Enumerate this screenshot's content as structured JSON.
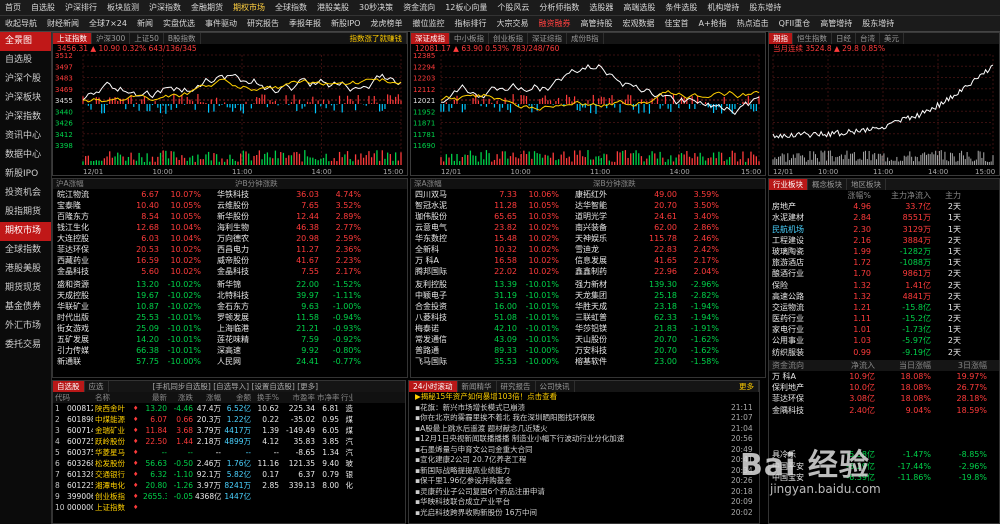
{
  "menu1": [
    "首页",
    "自选股",
    "沪深排行",
    "板块监测",
    "沪深指数",
    "金融期货",
    "期权市场",
    "全球指数",
    "港股美股",
    "30秒决策",
    "资金流向",
    "12板心向量",
    "个股风云",
    "分析师指数",
    "选股器",
    "高端选股",
    "条件选股",
    "机构增持",
    "股东增持"
  ],
  "menu2": [
    "收起导航",
    "财经新闻",
    "全球7×24",
    "新闻",
    "实盘优选",
    "事件驱动",
    "研究报告",
    "季报年报",
    "新股IPO",
    "龙虎榜单",
    "撤位监控",
    "指标排行",
    "大宗交易",
    "融资融券",
    "高管持股",
    "宏观数据",
    "佳宝首",
    "A+抢指",
    "热点追击",
    "QFII重仓",
    "高管增持",
    "股东增持"
  ],
  "sidebar": [
    "全景图",
    "自选股",
    "沪深个股",
    "沪深板块",
    "沪深指数",
    "资讯中心",
    "数据中心",
    "新股IPO",
    "投资机会",
    "股指期货",
    "期权市场",
    "全球指数",
    "港股美股",
    "期货现货",
    "基金债券",
    "外汇市场",
    "委托交易"
  ],
  "p1": {
    "tabs": [
      "上证指数",
      "沪深300",
      "上证50",
      "B股指数"
    ],
    "right": "指数涨了就赚钱",
    "info": "3456.31 ▲ 10.90  0.32%  643/136/345",
    "yl": [
      "3512",
      "3497",
      "3483",
      "3469",
      "3455",
      "3440",
      "3426",
      "3412",
      "3398"
    ],
    "xl": [
      "12/01",
      "10:00",
      "11:00",
      "14:00",
      "15:00"
    ]
  },
  "p2": {
    "tabs": [
      "深证成指",
      "中小板指",
      "创业板指",
      "深证综指",
      "成份B指"
    ],
    "info": "12081.17 ▲ 63.90  0.53%  783/248/760",
    "yl": [
      "12385",
      "12294",
      "12203",
      "12112",
      "12021",
      "11952",
      "11871",
      "11781",
      "11690"
    ],
    "xl": [
      "12/01",
      "10:00",
      "11:00",
      "14:00",
      "15:00"
    ]
  },
  "p3": {
    "tabs": [
      "期指",
      "恒生指数",
      "日经",
      "台湾",
      "美元"
    ],
    "info": "当月连续  3524.8 ▲ 29.8  0.85%",
    "xl": [
      "12/01",
      "10:00",
      "11:00",
      "14:00",
      "15:00"
    ]
  },
  "rankL": {
    "hdA": "沪A涨幅",
    "hdB": "沪B分钟涨跌",
    "up": [
      [
        "皖江物流",
        "6.67",
        "10.07%",
        "华铁科技",
        "36.03",
        "4.74%"
      ],
      [
        "宝泰隆",
        "10.40",
        "10.05%",
        "云维股份",
        "7.65",
        "3.52%"
      ],
      [
        "百隆东方",
        "8.54",
        "10.05%",
        "新华股份",
        "12.44",
        "2.89%"
      ],
      [
        "钱江生化",
        "12.68",
        "10.04%",
        "海利生物",
        "46.38",
        "2.77%"
      ],
      [
        "大连控股",
        "6.03",
        "10.04%",
        "万向德农",
        "20.98",
        "2.59%"
      ],
      [
        "菲达环保",
        "20.53",
        "10.02%",
        "西昌电力",
        "11.27",
        "2.36%"
      ],
      [
        "西藏药业",
        "16.59",
        "10.02%",
        "威帝股份",
        "41.67",
        "2.23%"
      ],
      [
        "金晶科技",
        "5.60",
        "10.02%",
        "金晶科技",
        "7.55",
        "2.17%"
      ]
    ],
    "dn": [
      [
        "盛和资源",
        "13.20",
        "-10.02%",
        "新华锦",
        "22.00",
        "-1.52%"
      ],
      [
        "天成控股",
        "19.67",
        "-10.02%",
        "北特科技",
        "39.97",
        "-1.11%"
      ],
      [
        "华联矿业",
        "10.87",
        "-10.02%",
        "金石东方",
        "9.63",
        "-1.00%"
      ],
      [
        "时代出版",
        "25.53",
        "-10.01%",
        "罗顿发展",
        "11.58",
        "-0.94%"
      ],
      [
        "街女游戏",
        "25.09",
        "-10.01%",
        "上海临港",
        "21.21",
        "-0.93%"
      ],
      [
        "五矿发展",
        "14.20",
        "-10.01%",
        "莲花味精",
        "7.59",
        "-0.92%"
      ],
      [
        "引力传媒",
        "66.38",
        "-10.01%",
        "深高速",
        "9.92",
        "-0.80%"
      ],
      [
        "新通联",
        "57.75",
        "-10.00%",
        "人民网",
        "24.41",
        "-0.77%"
      ]
    ]
  },
  "rankR": {
    "hdA": "深A涨幅",
    "hdB": "深B分钟涨跌",
    "up": [
      [
        "四川双马",
        "7.33",
        "10.06%",
        "康拓红外",
        "49.00",
        "3.59%"
      ],
      [
        "智冠水泥",
        "11.28",
        "10.05%",
        "达华智能",
        "20.70",
        "3.50%"
      ],
      [
        "珈伟股份",
        "65.65",
        "10.03%",
        "道明光学",
        "24.61",
        "3.40%"
      ],
      [
        "云意电气",
        "23.82",
        "10.02%",
        "南兴装备",
        "62.00",
        "2.86%"
      ],
      [
        "华东数控",
        "15.48",
        "10.02%",
        "天神娱乐",
        "115.78",
        "2.46%"
      ],
      [
        "全新科",
        "10.32",
        "10.02%",
        "雪迪龙",
        "22.83",
        "2.42%"
      ],
      [
        "万 科A",
        "16.58",
        "10.02%",
        "信息发展",
        "41.65",
        "2.17%"
      ],
      [
        "腾邦国际",
        "22.02",
        "10.02%",
        "鑫鑫制药",
        "22.96",
        "2.04%"
      ]
    ],
    "dn": [
      [
        "友利控股",
        "13.39",
        "-10.01%",
        "强力新材",
        "139.30",
        "-2.96%"
      ],
      [
        "中颖电子",
        "31.19",
        "-10.01%",
        "天龙集团",
        "25.18",
        "-2.82%"
      ],
      [
        "合金投资",
        "16.00",
        "-10.01%",
        "华胜天成",
        "23.18",
        "-1.94%"
      ],
      [
        "八菱科技",
        "51.08",
        "-10.01%",
        "三联虹普",
        "62.33",
        "-1.94%"
      ],
      [
        "梅泰诺",
        "42.10",
        "-10.01%",
        "华莎铝镁",
        "21.83",
        "-1.91%"
      ],
      [
        "常发通信",
        "43.09",
        "-10.01%",
        "天山股份",
        "20.70",
        "-1.62%"
      ],
      [
        "普路通",
        "89.33",
        "-10.00%",
        "万安科技",
        "20.70",
        "-1.62%"
      ],
      [
        "飞马国际",
        "35.53",
        "-10.00%",
        "榕基软件",
        "23.00",
        "-1.58%"
      ]
    ]
  },
  "sector": {
    "tabs": [
      "行业板块",
      "概念板块",
      "地区板块"
    ],
    "hd": [
      "",
      "涨幅%",
      "主力净流入",
      "主力"
    ],
    "rows": [
      [
        "房地产",
        "4.96",
        "33.7亿",
        "2天"
      ],
      [
        "水泥建材",
        "2.84",
        "8551万",
        "1天"
      ],
      [
        "民航机场",
        "2.30",
        "3129万",
        "1天"
      ],
      [
        "工程建设",
        "2.16",
        "3884万",
        "2天"
      ],
      [
        "玻璃陶瓷",
        "1.99",
        "-1282万",
        "1天"
      ],
      [
        "旅游酒店",
        "1.72",
        "-1088万",
        "1天"
      ],
      [
        "酿酒行业",
        "1.70",
        "9861万",
        "2天"
      ],
      [
        "保险",
        "1.32",
        "1.41亿",
        "2天"
      ],
      [
        "高速公路",
        "1.32",
        "4841万",
        "2天"
      ],
      [
        "交运物流",
        "1.21",
        "-15.8亿",
        "1天"
      ],
      [
        "医药行业",
        "1.11",
        "-15.2亿",
        "2天"
      ],
      [
        "家电行业",
        "1.01",
        "-1.73亿",
        "1天"
      ],
      [
        "公用事业",
        "1.03",
        "-5.97亿",
        "2天"
      ],
      [
        "纺织服装",
        "0.99",
        "-9.19亿",
        "2天"
      ]
    ],
    "hd2": [
      "资金流向",
      "净流入",
      "当日涨幅",
      "3日涨幅"
    ],
    "flow": [
      [
        "万 科A",
        "10.9亿",
        "18.08%",
        "19.97%"
      ],
      [
        "保利地产",
        "10.0亿",
        "18.08%",
        "26.77%"
      ],
      [
        "菲达环保",
        "3.08亿",
        "18.08%",
        "28.18%"
      ],
      [
        "金隅科技",
        "2.40亿",
        "9.04%",
        "18.59%"
      ],
      [
        "",
        "",
        "",
        "",
        ""
      ],
      [
        "",
        "",
        "",
        ""
      ],
      [
        "",
        "",
        "",
        ""
      ],
      [
        "具冷乐",
        "-5.38亿",
        "-1.47%",
        "-8.85%"
      ],
      [
        "中国平安",
        "-6.29亿",
        "-17.44%",
        "-2.96%"
      ],
      [
        "中国宝安",
        "-6.39亿",
        "-11.86%",
        "-19.8%"
      ]
    ]
  },
  "wl": {
    "tabs": [
      "自选股",
      "应选"
    ],
    "mid": "[手机同步自选股] [自选导入] [设置自选股] [更多]",
    "hd": [
      "代码",
      "名称",
      "",
      "最新",
      "涨跌",
      "涨幅",
      "金额",
      "换手%",
      "市盈率",
      "市净率",
      "行业"
    ],
    "rows": [
      [
        "1",
        "000812",
        "陕西金叶",
        "13.20",
        "-4.46",
        "47.4万",
        "6.52亿",
        "10.62",
        "225.34",
        "6.81",
        "造"
      ],
      [
        "2",
        "601898",
        "中煤能源",
        "6.07",
        "0.66",
        "20.3万",
        "1.22亿",
        "0.22",
        "-35.02",
        "0.95",
        "煤"
      ],
      [
        "3",
        "600714",
        "金瑞矿业",
        "11.84",
        "3.68",
        "3.79万",
        "4417万",
        "1.39",
        "-149.49",
        "6.05",
        "煤"
      ],
      [
        "4",
        "600725",
        "跃岭股份",
        "22.50",
        "1.44",
        "2.18万",
        "4899万",
        "4.12",
        "35.83",
        "3.85",
        "汽"
      ],
      [
        "5",
        "600375",
        "华菱星马",
        "--",
        "--",
        "--",
        "--",
        "--",
        "-8.65",
        "1.34",
        "汽"
      ],
      [
        "6",
        "603268",
        "松发股份",
        "56.63",
        "-0.50",
        "2.46万",
        "1.76亿",
        "11.16",
        "121.35",
        "9.40",
        "玻"
      ],
      [
        "7",
        "601328",
        "交通银行",
        "6.32",
        "-1.10",
        "92.1万",
        "5.82亿",
        "0.17",
        "6.37",
        "0.79",
        "银"
      ],
      [
        "8",
        "601225",
        "湘潭电化",
        "20.80",
        "-1.26",
        "3.97万",
        "8241万",
        "2.85",
        "339.13",
        "8.00",
        "化"
      ],
      [
        "9",
        "399006",
        "创业板指",
        "2655.34",
        "-0.05",
        "4368亿",
        "1447亿",
        "",
        "",
        "",
        ""
      ],
      [
        "10",
        "000000",
        "上证指数",
        "",
        "",
        "",
        "",
        "",
        "",
        "",
        ""
      ]
    ]
  },
  "news": {
    "tabs": [
      "24小时滚动",
      "新闻精华",
      "研究报告",
      "公司快讯"
    ],
    "more": "更多",
    "rows": [
      [
        "▶揭秘15年资产如何暴增103倍！点击查看",
        ""
      ],
      [
        "▪花旗：新兴市场增长模式已崩溃",
        "21:11"
      ],
      [
        "▪你在北京的雾霾里挨不着北 我在深圳晒阳图找环保股",
        "21:07"
      ],
      [
        "▪A股最上跳水后遥渡 题材献念几近矮火",
        "21:04"
      ],
      [
        "▪12月1日央视新闻联播播播 制造业小幅下行波动行业分化加速",
        "20:56"
      ],
      [
        "▪石墨烯量与申育文公司金重大合同",
        "20:49"
      ],
      [
        "▪宣化建康2公司 20.7亿养老工程",
        "20:41"
      ],
      [
        "▪新国际战略提提高业绩能力",
        "20:34"
      ],
      [
        "▪保千里1.96亿参设并购基金",
        "20:26"
      ],
      [
        "▪灵康药业子公司复国6个药品注册申请",
        "20:18"
      ],
      [
        "▪华映科技联合成立产业平台",
        "20:09"
      ],
      [
        "▪光启科技跨界收购新股份 16万中间",
        "20:02"
      ]
    ]
  },
  "watermark": {
    "brand": "Bai 经验",
    "url": "jingyan.baidu.com"
  },
  "colors": {
    "up": "#ff3b3b",
    "down": "#00d24a",
    "accent": "#c01818"
  }
}
